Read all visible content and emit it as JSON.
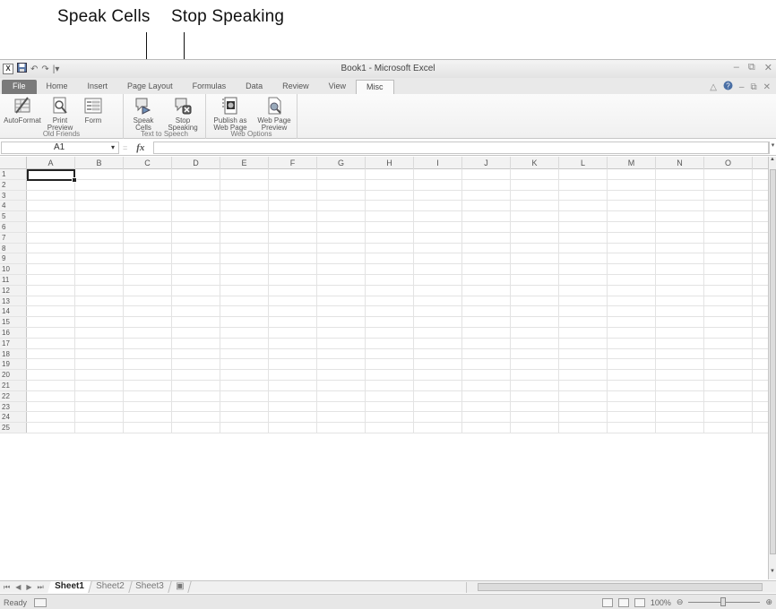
{
  "callouts": {
    "speak_cells": "Speak Cells",
    "stop_speaking": "Stop Speaking"
  },
  "window": {
    "title": "Book1 - Microsoft Excel"
  },
  "qat": {
    "app_icon": "X",
    "undo": "↶",
    "redo": "↷",
    "customize": "|▾"
  },
  "window_controls": {
    "minimize": "–",
    "restore": "⧉",
    "close": "✕"
  },
  "tabs": [
    "File",
    "Home",
    "Insert",
    "Page Layout",
    "Formulas",
    "Data",
    "Review",
    "View",
    "Misc"
  ],
  "active_tab": "Misc",
  "ribbon": {
    "groups": [
      {
        "label": "Old Friends",
        "buttons": [
          {
            "label": "AutoFormat",
            "icon": "autoformat-icon"
          },
          {
            "label": "Print\nPreview",
            "icon": "print-preview-icon"
          },
          {
            "label": "Form",
            "icon": "form-icon"
          }
        ]
      },
      {
        "label": "Text to Speech",
        "buttons": [
          {
            "label": "Speak\nCells",
            "icon": "speak-cells-icon"
          },
          {
            "label": "Stop\nSpeaking",
            "icon": "stop-speaking-icon"
          }
        ]
      },
      {
        "label": "Web Options",
        "buttons": [
          {
            "label": "Publish as\nWeb Page",
            "icon": "publish-web-icon"
          },
          {
            "label": "Web Page\nPreview",
            "icon": "web-preview-icon"
          }
        ]
      }
    ]
  },
  "formula_bar": {
    "name_box": "A1",
    "fx": "fx",
    "formula": ""
  },
  "columns": [
    "A",
    "B",
    "C",
    "D",
    "E",
    "F",
    "G",
    "H",
    "I",
    "J",
    "K",
    "L",
    "M",
    "N",
    "O"
  ],
  "rows": [
    "1",
    "2",
    "3",
    "4",
    "5",
    "6",
    "7",
    "8",
    "9",
    "10",
    "11",
    "12",
    "13",
    "14",
    "15",
    "16",
    "17",
    "18",
    "19",
    "20",
    "21",
    "22",
    "23",
    "24",
    "25"
  ],
  "sheets": [
    "Sheet1",
    "Sheet2",
    "Sheet3"
  ],
  "active_sheet": "Sheet1",
  "status": {
    "ready": "Ready",
    "zoom": "100%"
  }
}
